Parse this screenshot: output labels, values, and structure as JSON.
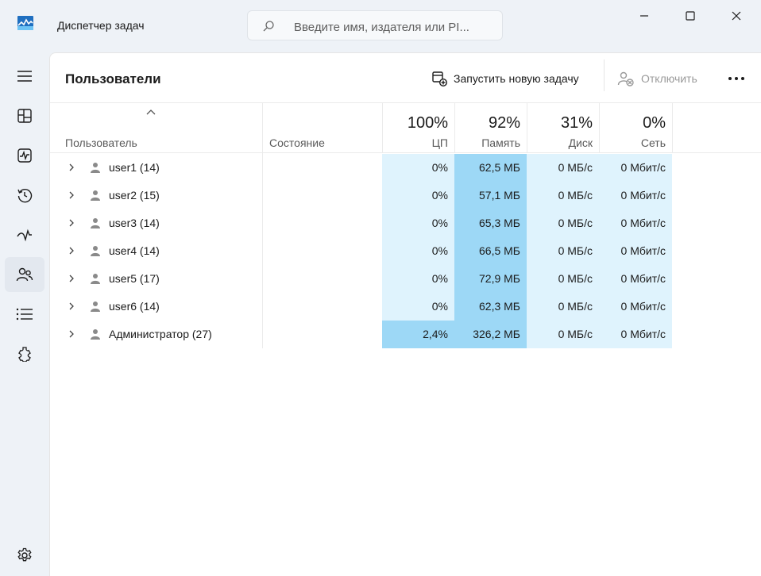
{
  "app": {
    "title": "Диспетчер задач"
  },
  "search": {
    "placeholder": "Введите имя, издателя или PI..."
  },
  "page": {
    "title": "Пользователи"
  },
  "toolbar": {
    "run_task_label": "Запустить новую задачу",
    "disconnect_label": "Отключить"
  },
  "nav": {
    "items": [
      "menu-icon",
      "processes-icon",
      "performance-icon",
      "app-history-icon",
      "startup-apps-icon",
      "users-icon",
      "details-icon",
      "services-icon",
      "settings-icon"
    ],
    "active": "users-icon"
  },
  "columns": {
    "user": "Пользователь",
    "status": "Состояние",
    "cpu": {
      "percent": "100%",
      "label": "ЦП"
    },
    "memory": {
      "percent": "92%",
      "label": "Память"
    },
    "disk": {
      "percent": "31%",
      "label": "Диск"
    },
    "network": {
      "percent": "0%",
      "label": "Сеть"
    }
  },
  "rows": [
    {
      "name": "user1 (14)",
      "status": "",
      "cpu": "0%",
      "memory": "62,5 МБ",
      "disk": "0 МБ/с",
      "network": "0 Мбит/с"
    },
    {
      "name": "user2 (15)",
      "status": "",
      "cpu": "0%",
      "memory": "57,1 МБ",
      "disk": "0 МБ/с",
      "network": "0 Мбит/с"
    },
    {
      "name": "user3 (14)",
      "status": "",
      "cpu": "0%",
      "memory": "65,3 МБ",
      "disk": "0 МБ/с",
      "network": "0 Мбит/с"
    },
    {
      "name": "user4 (14)",
      "status": "",
      "cpu": "0%",
      "memory": "66,5 МБ",
      "disk": "0 МБ/с",
      "network": "0 Мбит/с"
    },
    {
      "name": "user5 (17)",
      "status": "",
      "cpu": "0%",
      "memory": "72,9 МБ",
      "disk": "0 МБ/с",
      "network": "0 Мбит/с"
    },
    {
      "name": "user6 (14)",
      "status": "",
      "cpu": "0%",
      "memory": "62,3 МБ",
      "disk": "0 МБ/с",
      "network": "0 Мбит/с"
    },
    {
      "name": "Администратор (27)",
      "status": "",
      "cpu": "2,4%",
      "memory": "326,2 МБ",
      "disk": "0 МБ/с",
      "network": "0 Мбит/с"
    }
  ],
  "colors": {
    "heat_light": "#dff3fd",
    "heat_mid": "#bde6fa",
    "heat_strong": "#9dd8f6",
    "accent": "#0067c0"
  }
}
